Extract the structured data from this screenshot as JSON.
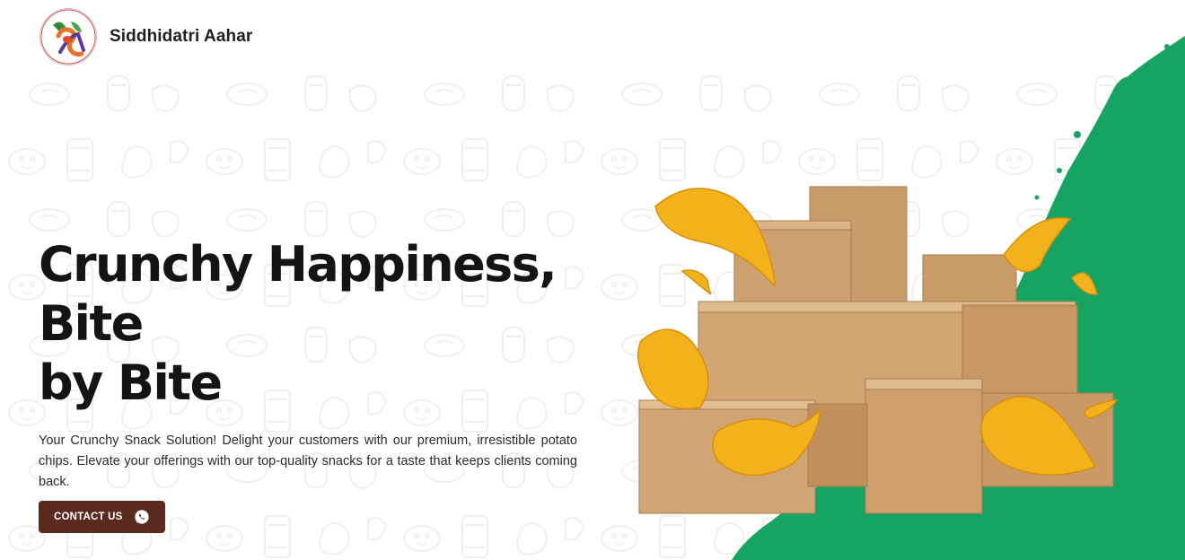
{
  "header": {
    "logo_name": "siddhidatri-aahar-logo",
    "brand_name": "Siddhidatri Aahar"
  },
  "hero": {
    "title_line1": "Crunchy Happiness, Bite",
    "title_line2": "by Bite",
    "description": "Your Crunchy Snack Solution! Delight your customers with our premium, irresistible potato chips. Elevate your offerings with our top-quality snacks for a taste that keeps clients coming back.",
    "cta_label": "CONTACT US",
    "cta_icon": "whatsapp-icon",
    "image_subject": "cardboard-boxes-with-potato-chips"
  },
  "colors": {
    "button_bg": "#5b2a1e",
    "accent_green": "#17a463",
    "chip_yellow": "#f2b21c",
    "box_brown": "#c89a66",
    "background": "#ffffff"
  }
}
